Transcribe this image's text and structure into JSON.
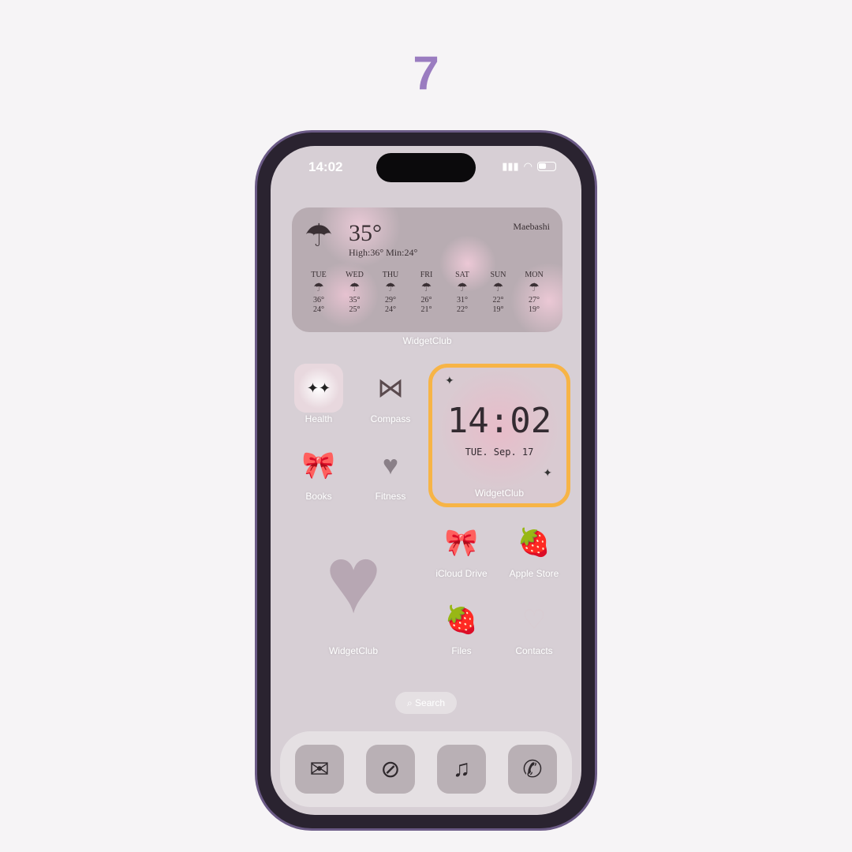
{
  "step_number": "7",
  "status": {
    "time": "14:02"
  },
  "weather": {
    "temp": "35°",
    "high_low": "High:36° Min:24°",
    "city": "Maebashi",
    "label": "WidgetClub",
    "days": [
      {
        "d": "TUE",
        "hi": "36°",
        "lo": "24°"
      },
      {
        "d": "WED",
        "hi": "35°",
        "lo": "25°"
      },
      {
        "d": "THU",
        "hi": "29°",
        "lo": "24°"
      },
      {
        "d": "FRI",
        "hi": "26°",
        "lo": "21°"
      },
      {
        "d": "SAT",
        "hi": "31°",
        "lo": "22°"
      },
      {
        "d": "SUN",
        "hi": "22°",
        "lo": "19°"
      },
      {
        "d": "MON",
        "hi": "27°",
        "lo": "19°"
      }
    ]
  },
  "apps": {
    "health": "Health",
    "compass": "Compass",
    "books": "Books",
    "fitness": "Fitness",
    "icloud": "iCloud Drive",
    "apple_store": "Apple Store",
    "files": "Files",
    "contacts": "Contacts",
    "heart_widget": "WidgetClub"
  },
  "clock_widget": {
    "time": "14:02",
    "date": "TUE. Sep. 17",
    "label": "WidgetClub",
    "highlight_color": "#f7b446"
  },
  "search": "Search",
  "dock": [
    "mail-icon",
    "compass-icon",
    "music-icon",
    "phone-icon"
  ]
}
